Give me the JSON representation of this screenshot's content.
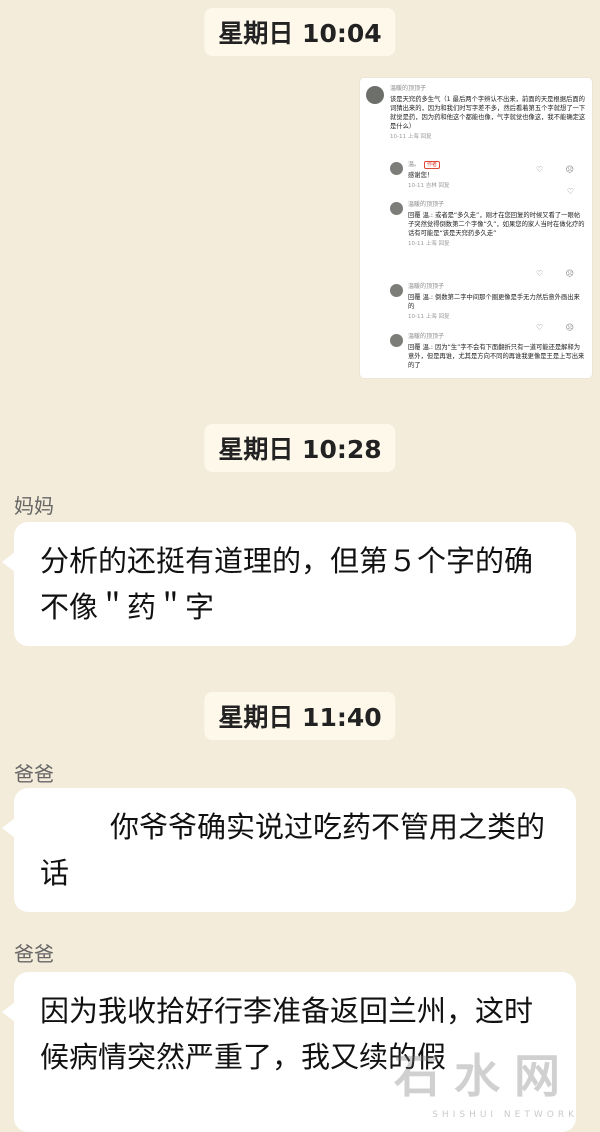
{
  "messages": [
    {
      "type": "timestamp",
      "text": "星期日 10:04"
    },
    {
      "type": "image"
    },
    {
      "type": "timestamp",
      "text": "星期日 10:28"
    },
    {
      "type": "text",
      "sender": "妈妈",
      "text": "分析的还挺有道理的，但第５个字的确不像＂药＂字"
    },
    {
      "type": "timestamp",
      "text": "星期日 11:40"
    },
    {
      "type": "text",
      "sender": "爸爸",
      "text": "你爷爷确实说过吃药不管用之类的话"
    },
    {
      "type": "text",
      "sender": "爸爸",
      "text": "因为我收拾好行李准备返回兰州，这时候病情突然严重了，我又续的假"
    }
  ],
  "screenshot": {
    "comments": [
      {
        "name": "温暖的顶顶子",
        "text": "该是天窍药多生气（1 最后两个字辨认不出来，前面的天是根据后面的词猜出来的，因为和我们时写字差不多，然后看着第五个字就想了一下就觉是药，因为药和他这个都能也像，气字就觉也像这，我不能确定这是什么）",
        "meta": "10-11 上海 回复",
        "icons": "♡ ☹"
      },
      {
        "name": "温。",
        "tag": "作者",
        "text": "感谢您！",
        "meta": "10-11 吉林 回复",
        "icons": "♡"
      },
      {
        "name": "温暖的顶顶子",
        "text": "回覆 温.: 或者是“多久走”，刚才在您回复的时候又看了一眼帖子突然觉得倒数第二个字像“久”，如果您的家人当时在做化疗的话有可能是“该是天窍药多久走”",
        "meta": "10-11 上海 回复",
        "icons": "♡ ☹"
      },
      {
        "name": "温暖的顶顶子",
        "text": "回覆 温.: 倒数第二字中间那个圈更像是手无力然后意外画出来的",
        "meta": "10-11 上海 回复",
        "icons": "♡ ☹"
      },
      {
        "name": "温暖的顶顶子",
        "text": "回覆 温.: 因为“生”字不会有下面翻折只有一道可能还是解释为意外，但是再谁，尤其是方向不同的再谁我更像是王是上写出来的了",
        "meta": "",
        "icons": ""
      }
    ]
  },
  "watermark": {
    "main": "石水网",
    "sub": "SHISHUI NETWORK"
  }
}
